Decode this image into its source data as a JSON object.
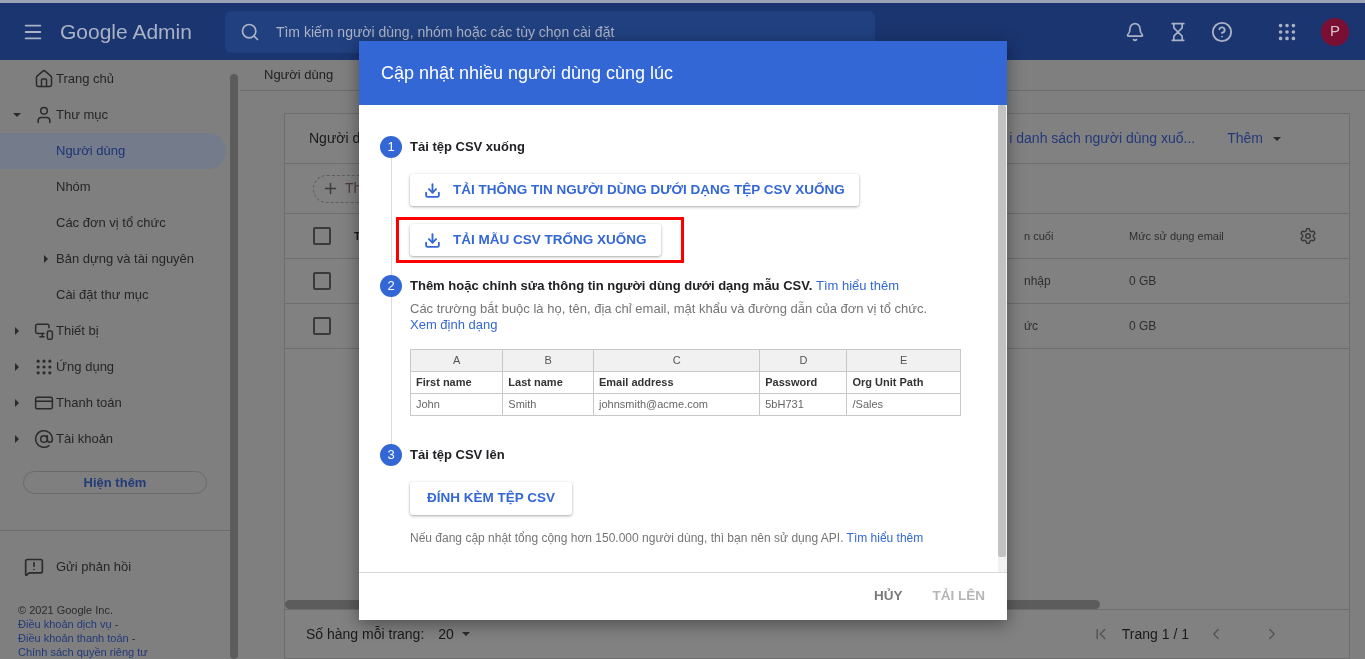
{
  "header": {
    "app_name": "Google Admin",
    "search_placeholder": "Tìm kiếm người dùng, nhóm hoặc các tùy chọn cài đặt",
    "avatar_letter": "P"
  },
  "sidebar": {
    "items": [
      {
        "label": "Trang chủ",
        "selected": false
      },
      {
        "label": "Thư mục",
        "selected": false,
        "expanded": true,
        "children": [
          {
            "label": "Người dùng",
            "selected": true
          },
          {
            "label": "Nhóm",
            "selected": false
          },
          {
            "label": "Các đơn vị tổ chức",
            "selected": false
          },
          {
            "label": "Bản dựng và tài nguyên",
            "selected": false,
            "expanded": false
          },
          {
            "label": "Cài đặt thư mục",
            "selected": false
          }
        ]
      },
      {
        "label": "Thiết bị",
        "selected": false,
        "expanded": false
      },
      {
        "label": "Ứng dụng",
        "selected": false,
        "expanded": false
      },
      {
        "label": "Thanh toán",
        "selected": false,
        "expanded": false
      },
      {
        "label": "Tài khoản",
        "selected": false,
        "expanded": false
      }
    ],
    "show_more": "Hiện thêm",
    "feedback": "Gửi phản hồi",
    "copyright": "© 2021 Google Inc.",
    "footer_links": [
      "Điều khoản dịch vụ",
      "Điều khoản thanh toán",
      "Chính sách quyền riêng tư"
    ],
    "footer_separator": "-"
  },
  "breadcrumb": "Người dùng",
  "users_card": {
    "title": "Người d",
    "download_link": "i danh sách người dùng xuố...",
    "more_menu": "Thêm",
    "filter_chip": "Th",
    "select_all_checked": false,
    "columns_left": [
      "T"
    ],
    "columns_right": [
      "n cuối",
      "Mức sử dụng email"
    ],
    "rows": [
      {
        "checked": false,
        "cells": [
          "nhập",
          "0 GB"
        ]
      },
      {
        "checked": false,
        "cells": [
          "ức",
          "0 GB"
        ]
      }
    ],
    "rows_per_page_label": "Số hàng mỗi trang:",
    "rows_per_page": "20",
    "page": "Trang 1 / 1"
  },
  "dialog": {
    "title": "Cập nhật nhiều người dùng cùng lúc",
    "steps": [
      {
        "kind": "download",
        "number": "1",
        "title": "Tải tệp CSV xuống",
        "buttons": [
          {
            "label": "TẢI THÔNG TIN NGƯỜI DÙNG DƯỚI DẠNG TỆP CSV XUỐNG",
            "highlighted": false
          },
          {
            "label": "TẢI MẪU CSV TRỐNG XUỐNG",
            "highlighted": true
          }
        ]
      },
      {
        "kind": "edit",
        "number": "2",
        "title": "Thêm hoặc chỉnh sửa thông tin người dùng dưới dạng mẫu CSV.",
        "link": "Tìm hiểu thêm",
        "description": "Các trường bắt buộc là họ, tên, địa chỉ email, mật khẩu và đường dẫn của đơn vị tổ chức.",
        "description_link": "Xem định dạng",
        "sample_table": {
          "letters": [
            "A",
            "B",
            "C",
            "D",
            "E"
          ],
          "header": [
            "First name",
            "Last name",
            "Email address",
            "Password",
            "Org Unit Path"
          ],
          "row": [
            "John",
            "Smith",
            "johnsmith@acme.com",
            "5bH731",
            "/Sales"
          ]
        }
      },
      {
        "kind": "upload",
        "number": "3",
        "title": "Tải tệp CSV lên",
        "button": "ĐÍNH KÈM TỆP CSV",
        "note": "Nếu đang cập nhật tổng cộng hơn 150.000 người dùng, thì bạn nên sử dụng API.",
        "note_link": "Tìm hiểu thêm"
      }
    ],
    "actions": [
      {
        "label": "HỦY",
        "disabled": false
      },
      {
        "label": "TẢI LÊN",
        "disabled": true
      }
    ]
  }
}
